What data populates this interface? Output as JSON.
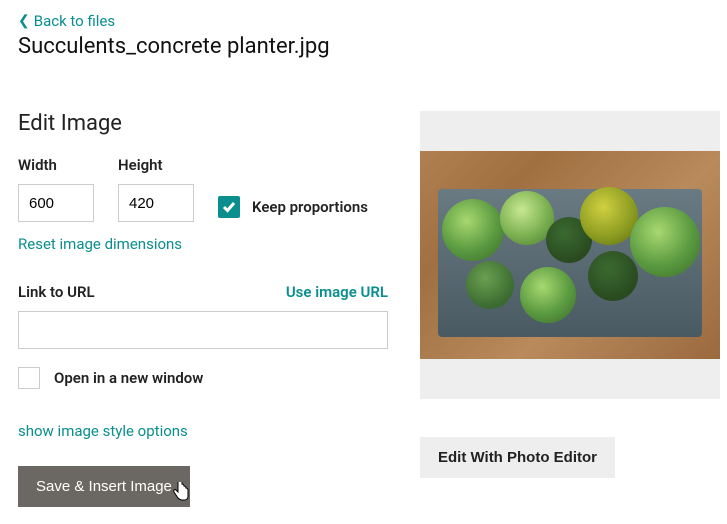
{
  "back_link": "Back to files",
  "filename": "Succulents_concrete planter.jpg",
  "edit_title": "Edit Image",
  "width_label": "Width",
  "height_label": "Height",
  "width_value": "600",
  "height_value": "420",
  "keep_proportions": "Keep proportions",
  "reset_link": "Reset image dimensions",
  "link_url_label": "Link to URL",
  "use_image_url": "Use image URL",
  "url_value": "",
  "open_new_window": "Open in a new window",
  "style_link": "show image style options",
  "save_button": "Save & Insert Image",
  "edit_photo_button": "Edit With Photo Editor"
}
